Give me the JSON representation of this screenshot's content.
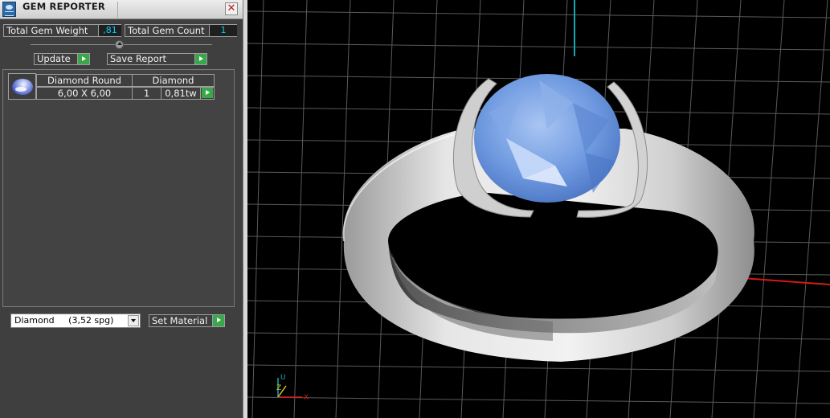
{
  "window": {
    "title": "GEM REPORTER",
    "close_glyph": "✕"
  },
  "summary": {
    "weight_label": "Total Gem Weight",
    "weight_value": ",81",
    "count_label": "Total Gem Count",
    "count_value": "1"
  },
  "actions": {
    "update_label": "Update",
    "save_report_label": "Save Report"
  },
  "gem_list": {
    "headers": [
      "Diamond Round",
      "Diamond"
    ],
    "rows": [
      {
        "size": "6,00 X 6,00",
        "quantity": "1",
        "weight": "0,81tw",
        "thumbnail": "gem-round-icon"
      }
    ]
  },
  "material": {
    "selected_name": "Diamond",
    "selected_density": "(3,52 spg)",
    "set_label": "Set Material"
  },
  "viewport": {
    "axes": {
      "u": "U",
      "x": "X",
      "z": "Z"
    },
    "colors": {
      "grid": "#5a5a5a",
      "x_axis": "#d21a1a",
      "y_axis": "#12a8b4",
      "gem": "#6f9ae0",
      "metal": "#d8d8d8"
    }
  },
  "icons": {
    "app": "gem-reporter-icon",
    "go": "play-arrow-icon",
    "dropdown": "chevron-down-icon",
    "close": "close-icon"
  }
}
